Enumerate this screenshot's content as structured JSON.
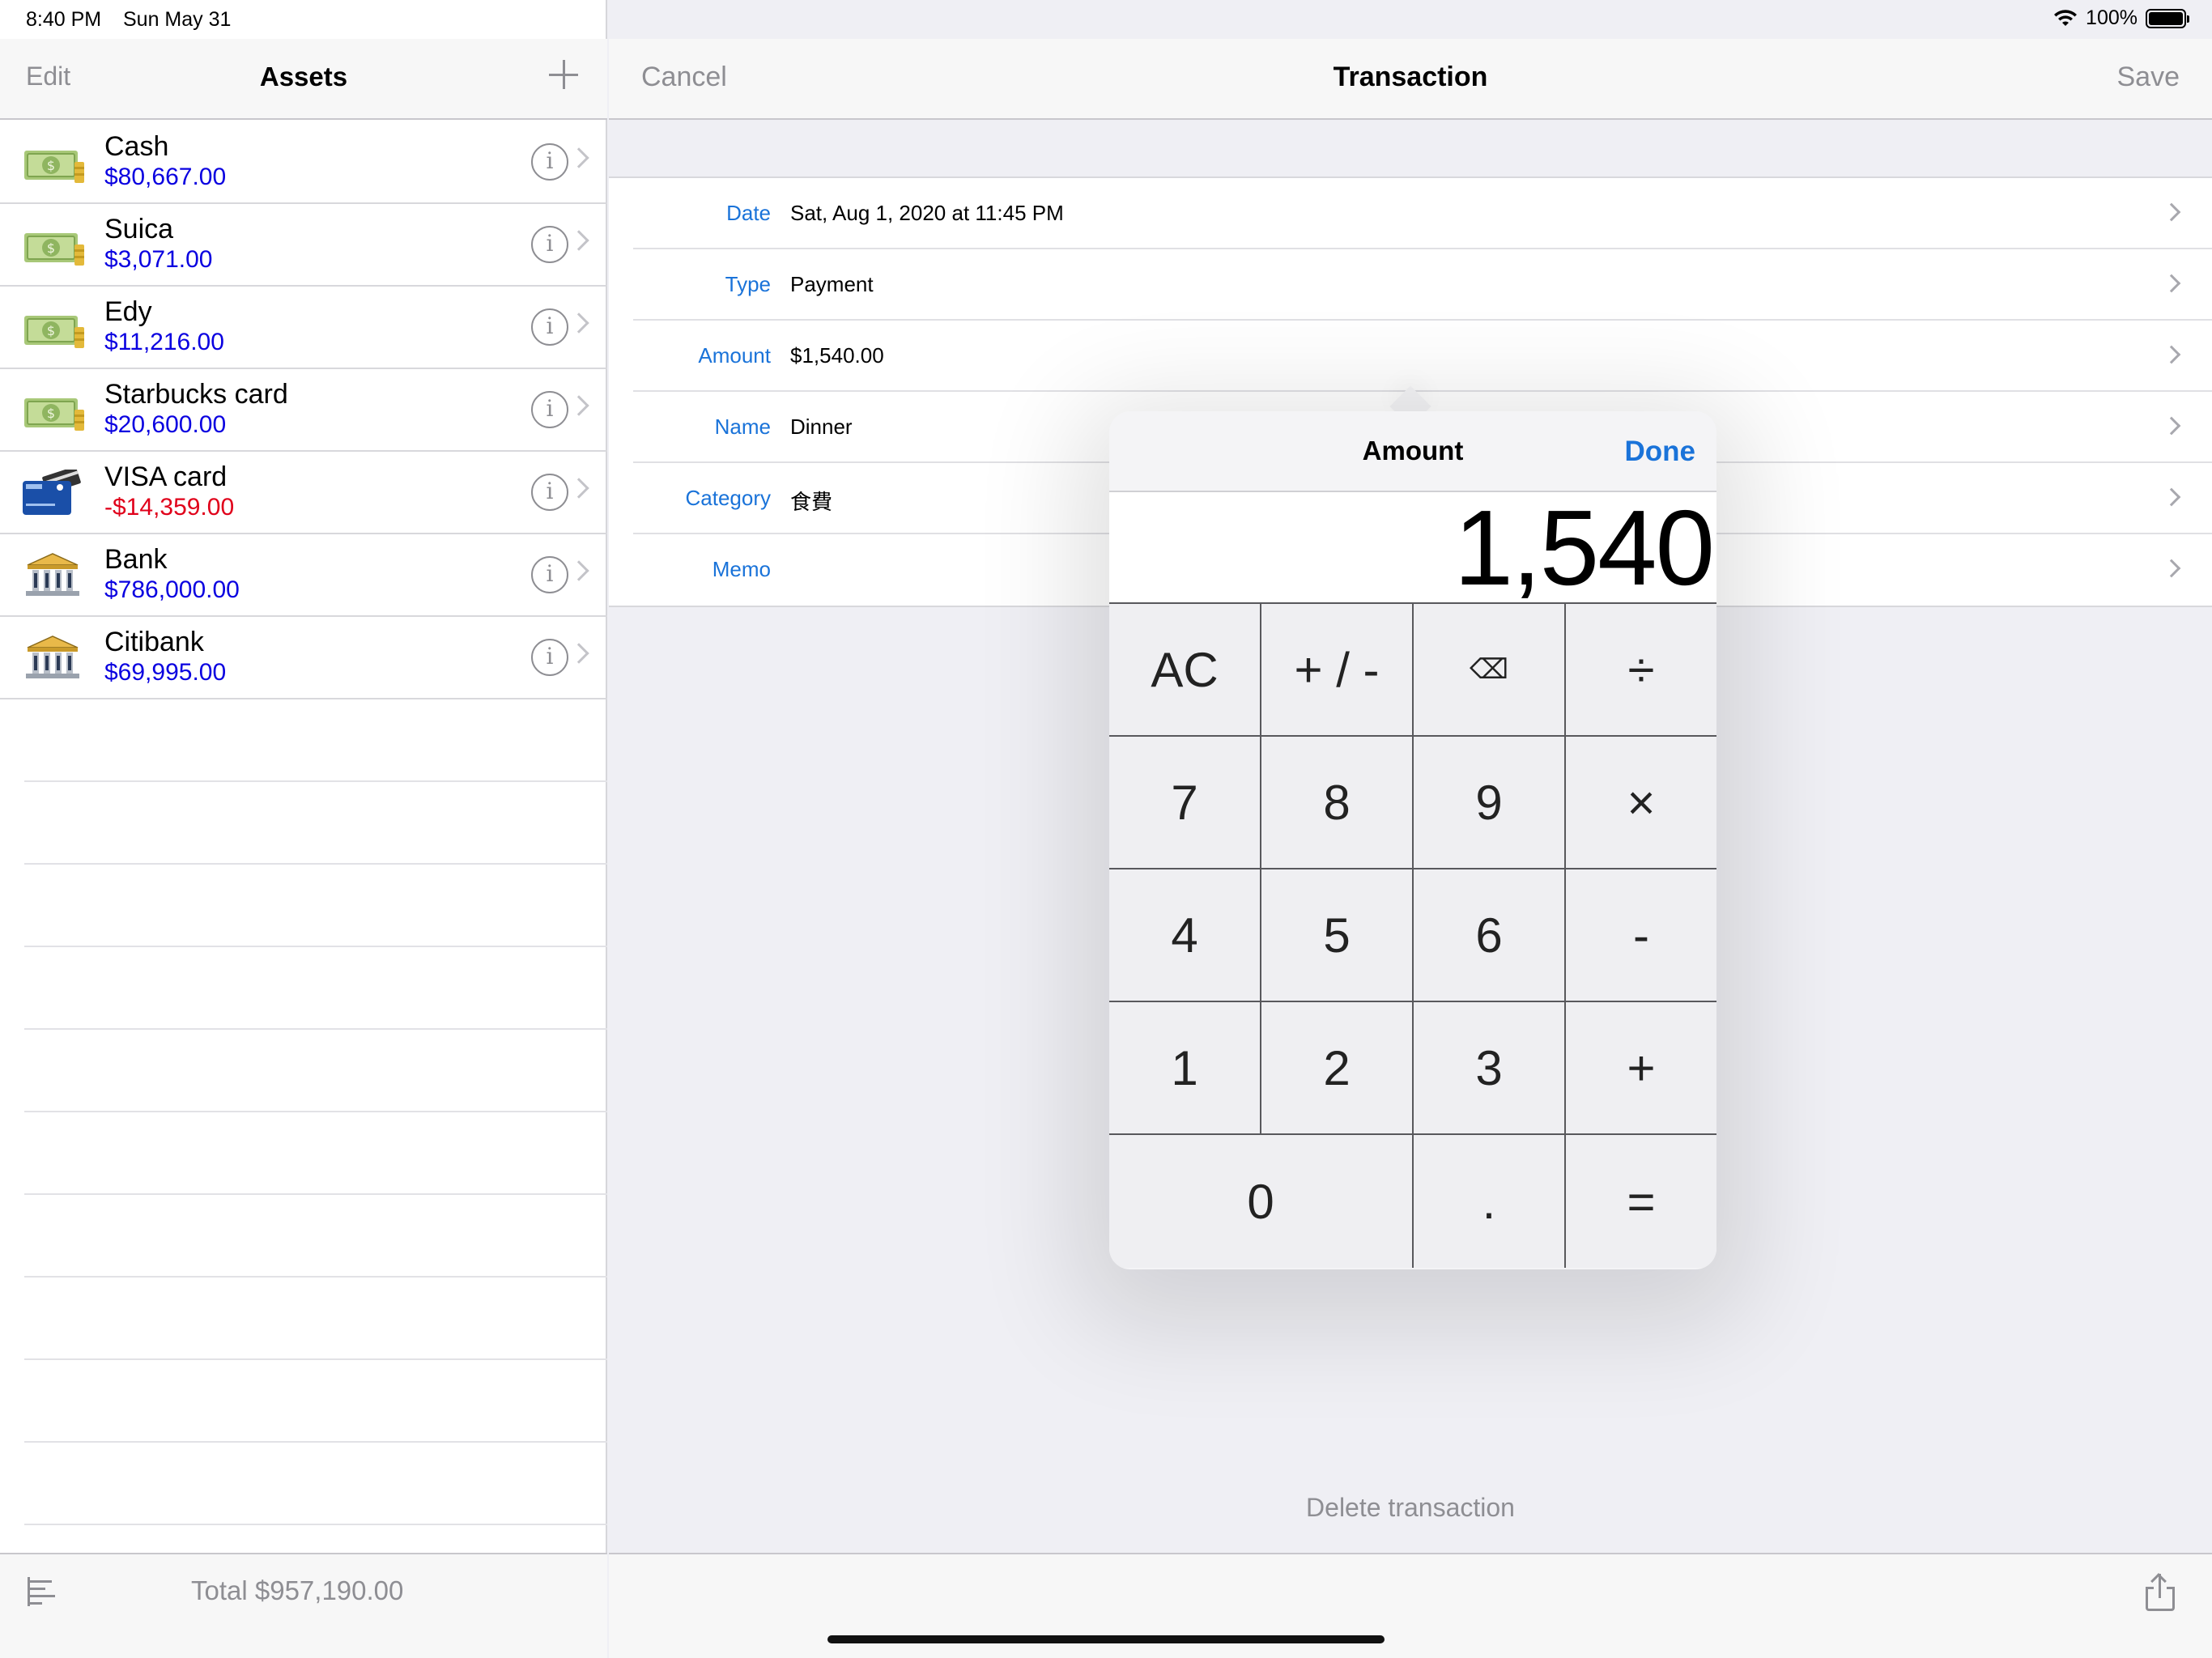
{
  "status_bar": {
    "time": "8:40 PM",
    "date": "Sun May 31",
    "battery": "100%"
  },
  "left": {
    "nav": {
      "edit": "Edit",
      "title": "Assets"
    },
    "assets": [
      {
        "name": "Cash",
        "amount": "$80,667.00",
        "icon": "money-icon",
        "negative": false
      },
      {
        "name": "Suica",
        "amount": "$3,071.00",
        "icon": "money-icon",
        "negative": false
      },
      {
        "name": "Edy",
        "amount": "$11,216.00",
        "icon": "money-icon",
        "negative": false
      },
      {
        "name": "Starbucks card",
        "amount": "$20,600.00",
        "icon": "money-icon",
        "negative": false
      },
      {
        "name": "VISA card",
        "amount": "-$14,359.00",
        "icon": "credit-card-icon",
        "negative": true
      },
      {
        "name": "Bank",
        "amount": "$786,000.00",
        "icon": "bank-icon",
        "negative": false
      },
      {
        "name": "Citibank",
        "amount": "$69,995.00",
        "icon": "bank-icon",
        "negative": false
      }
    ],
    "total": "Total $957,190.00"
  },
  "right": {
    "nav": {
      "cancel": "Cancel",
      "title": "Transaction",
      "save": "Save"
    },
    "fields": [
      {
        "label": "Date",
        "value": "Sat, Aug 1, 2020 at 11:45 PM"
      },
      {
        "label": "Type",
        "value": "Payment"
      },
      {
        "label": "Amount",
        "value": "$1,540.00"
      },
      {
        "label": "Name",
        "value": "Dinner"
      },
      {
        "label": "Category",
        "value": "食費"
      },
      {
        "label": "Memo",
        "value": ""
      }
    ],
    "delete": "Delete transaction"
  },
  "calculator": {
    "title": "Amount",
    "done": "Done",
    "display": "1,540",
    "keys": [
      "AC",
      "+ / -",
      "⌫",
      "÷",
      "7",
      "8",
      "9",
      "×",
      "4",
      "5",
      "6",
      "-",
      "1",
      "2",
      "3",
      "+",
      "0",
      ".",
      "="
    ]
  },
  "colors": {
    "accent": "#1a73d9",
    "positive": "#0a00e0",
    "negative": "#e0001a"
  }
}
